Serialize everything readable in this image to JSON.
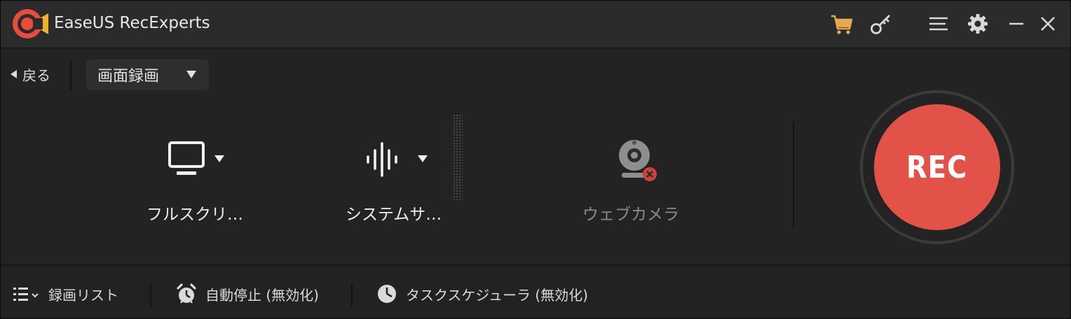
{
  "app": {
    "title": "EaseUS RecExperts",
    "logo_icon": "easeus-recexperts-logo",
    "accent_color": "#e25248"
  },
  "titlebar": {
    "icons": [
      "cart-icon",
      "key-icon",
      "menu-icon",
      "gear-icon",
      "minimize-icon",
      "close-icon"
    ]
  },
  "toolbar": {
    "back_label": "戻る",
    "mode_selected": "画面録画"
  },
  "sources": {
    "screen": {
      "label": "フルスクリ…",
      "icon": "monitor-icon"
    },
    "audio": {
      "label": "システムサ…",
      "icon": "audio-wave-icon"
    },
    "webcam": {
      "label": "ウェブカメラ",
      "icon": "webcam-disabled-icon"
    }
  },
  "record": {
    "label": "REC"
  },
  "bottombar": {
    "record_list": "録画リスト",
    "auto_stop": "自動停止 (無効化)",
    "task_scheduler": "タスクスケジューラ (無効化)"
  }
}
